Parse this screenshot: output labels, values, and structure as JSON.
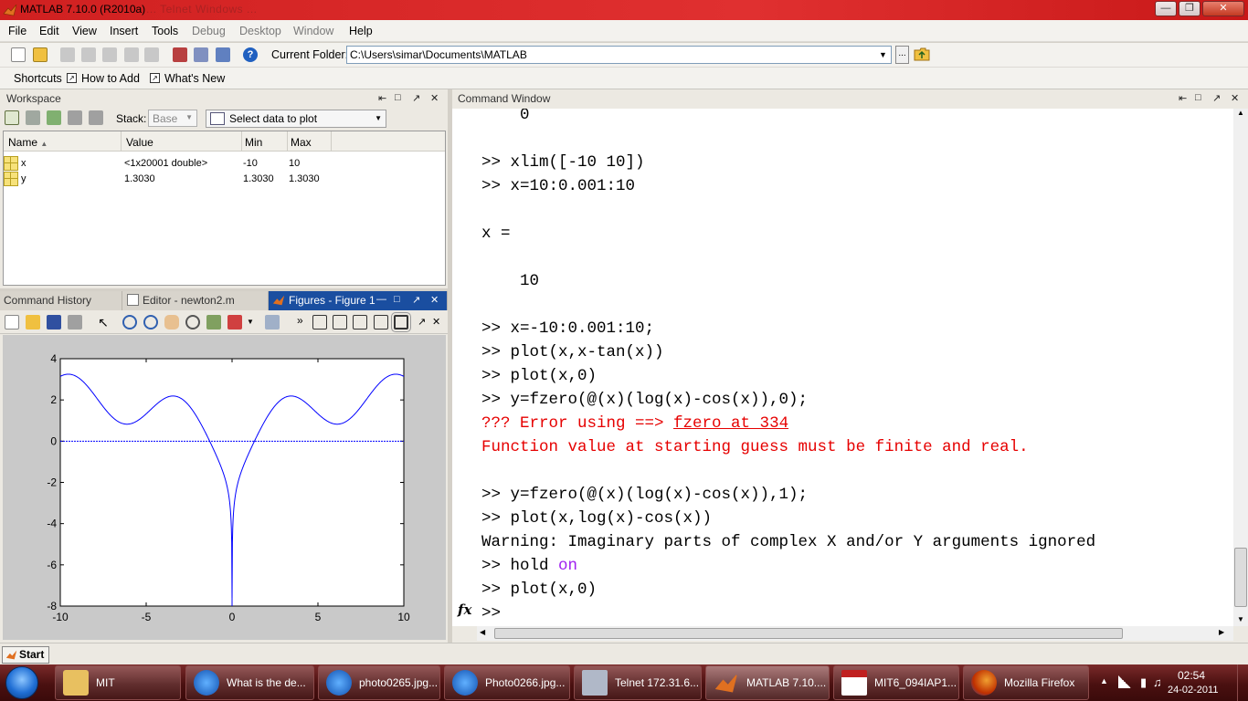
{
  "window": {
    "title": "MATLAB  7.10.0 (R2010a)",
    "ghost_title": "... Telnet  Windows  ..."
  },
  "menu": [
    "File",
    "Edit",
    "View",
    "Insert",
    "Tools",
    "Debug",
    "Desktop",
    "Window",
    "Help"
  ],
  "toolbar": {
    "current_folder_label": "Current Folder:",
    "current_folder_value": "C:\\Users\\simar\\Documents\\MATLAB",
    "browse_label": "..."
  },
  "shortcuts": {
    "shortcuts_label": "Shortcuts",
    "how_to_add": "How to Add",
    "whats_new": "What's New"
  },
  "workspace": {
    "title": "Workspace",
    "stack_label": "Stack:",
    "stack_value": "Base",
    "plot_selector": "Select data to plot",
    "columns": [
      "Name",
      "Value",
      "Min",
      "Max"
    ],
    "rows": [
      {
        "name": "x",
        "value": "<1x20001 double>",
        "min": "-10",
        "max": "10"
      },
      {
        "name": "y",
        "value": "1.3030",
        "min": "1.3030",
        "max": "1.3030"
      }
    ]
  },
  "figure_panel": {
    "tabs": [
      "Command History",
      "Editor - newton2.m",
      "Figures - Figure 1"
    ]
  },
  "command_window": {
    "title": "Command Window",
    "lines": [
      {
        "text": "    0",
        "cls": ""
      },
      {
        "text": "",
        "cls": ""
      },
      {
        "text": ">> xlim([-10 10])",
        "cls": ""
      },
      {
        "text": ">> x=10:0.001:10",
        "cls": ""
      },
      {
        "text": "",
        "cls": ""
      },
      {
        "text": "x =",
        "cls": ""
      },
      {
        "text": "",
        "cls": ""
      },
      {
        "text": "    10",
        "cls": ""
      },
      {
        "text": "",
        "cls": ""
      },
      {
        "text": ">> x=-10:0.001:10;",
        "cls": ""
      },
      {
        "text": ">> plot(x,x-tan(x))",
        "cls": ""
      },
      {
        "text": ">> plot(x,0)",
        "cls": ""
      },
      {
        "text": ">> y=fzero(@(x)(log(x)-cos(x)),0);",
        "cls": ""
      },
      {
        "text": "??? Error using ==> ",
        "cls": "err",
        "link": "fzero at 334"
      },
      {
        "text": "Function value at starting guess must be finite and real.",
        "cls": "err"
      },
      {
        "text": "",
        "cls": ""
      },
      {
        "text": ">> y=fzero(@(x)(log(x)-cos(x)),1);",
        "cls": ""
      },
      {
        "text": ">> plot(x,log(x)-cos(x))",
        "cls": ""
      },
      {
        "text": "Warning: Imaginary parts of complex X and/or Y arguments ignored",
        "cls": ""
      },
      {
        "text": ">> hold ",
        "cls": "",
        "kw": "on"
      },
      {
        "text": ">> plot(x,0)",
        "cls": ""
      },
      {
        "text": ">> ",
        "cls": ""
      }
    ],
    "fx_symbol": "fx"
  },
  "start_strip": {
    "label": "Start"
  },
  "taskbar": {
    "items": [
      "MIT",
      "What is the de...",
      "photo0265.jpg...",
      "Photo0266.jpg...",
      "Telnet 172.31.6...",
      "MATLAB  7.10....",
      "MIT6_094IAP1...",
      "Mozilla Firefox"
    ],
    "time": "02:54",
    "date": "24-02-2011"
  },
  "chart_data": {
    "type": "line",
    "xlim": [
      -10,
      10
    ],
    "ylim": [
      -8,
      4
    ],
    "xticks": [
      "-10",
      "-5",
      "0",
      "5",
      "10"
    ],
    "yticks": [
      "4",
      "2",
      "0",
      "-2",
      "-4",
      "-6",
      "-8"
    ],
    "series": [
      {
        "formula": "log|x| - cos(x)",
        "color": "#0000ff",
        "x_min": -10,
        "x_max": 10,
        "y_floor": -7.6
      },
      {
        "formula": "y = 0",
        "color": "#0000ff",
        "values": [
          0,
          0
        ]
      }
    ]
  }
}
